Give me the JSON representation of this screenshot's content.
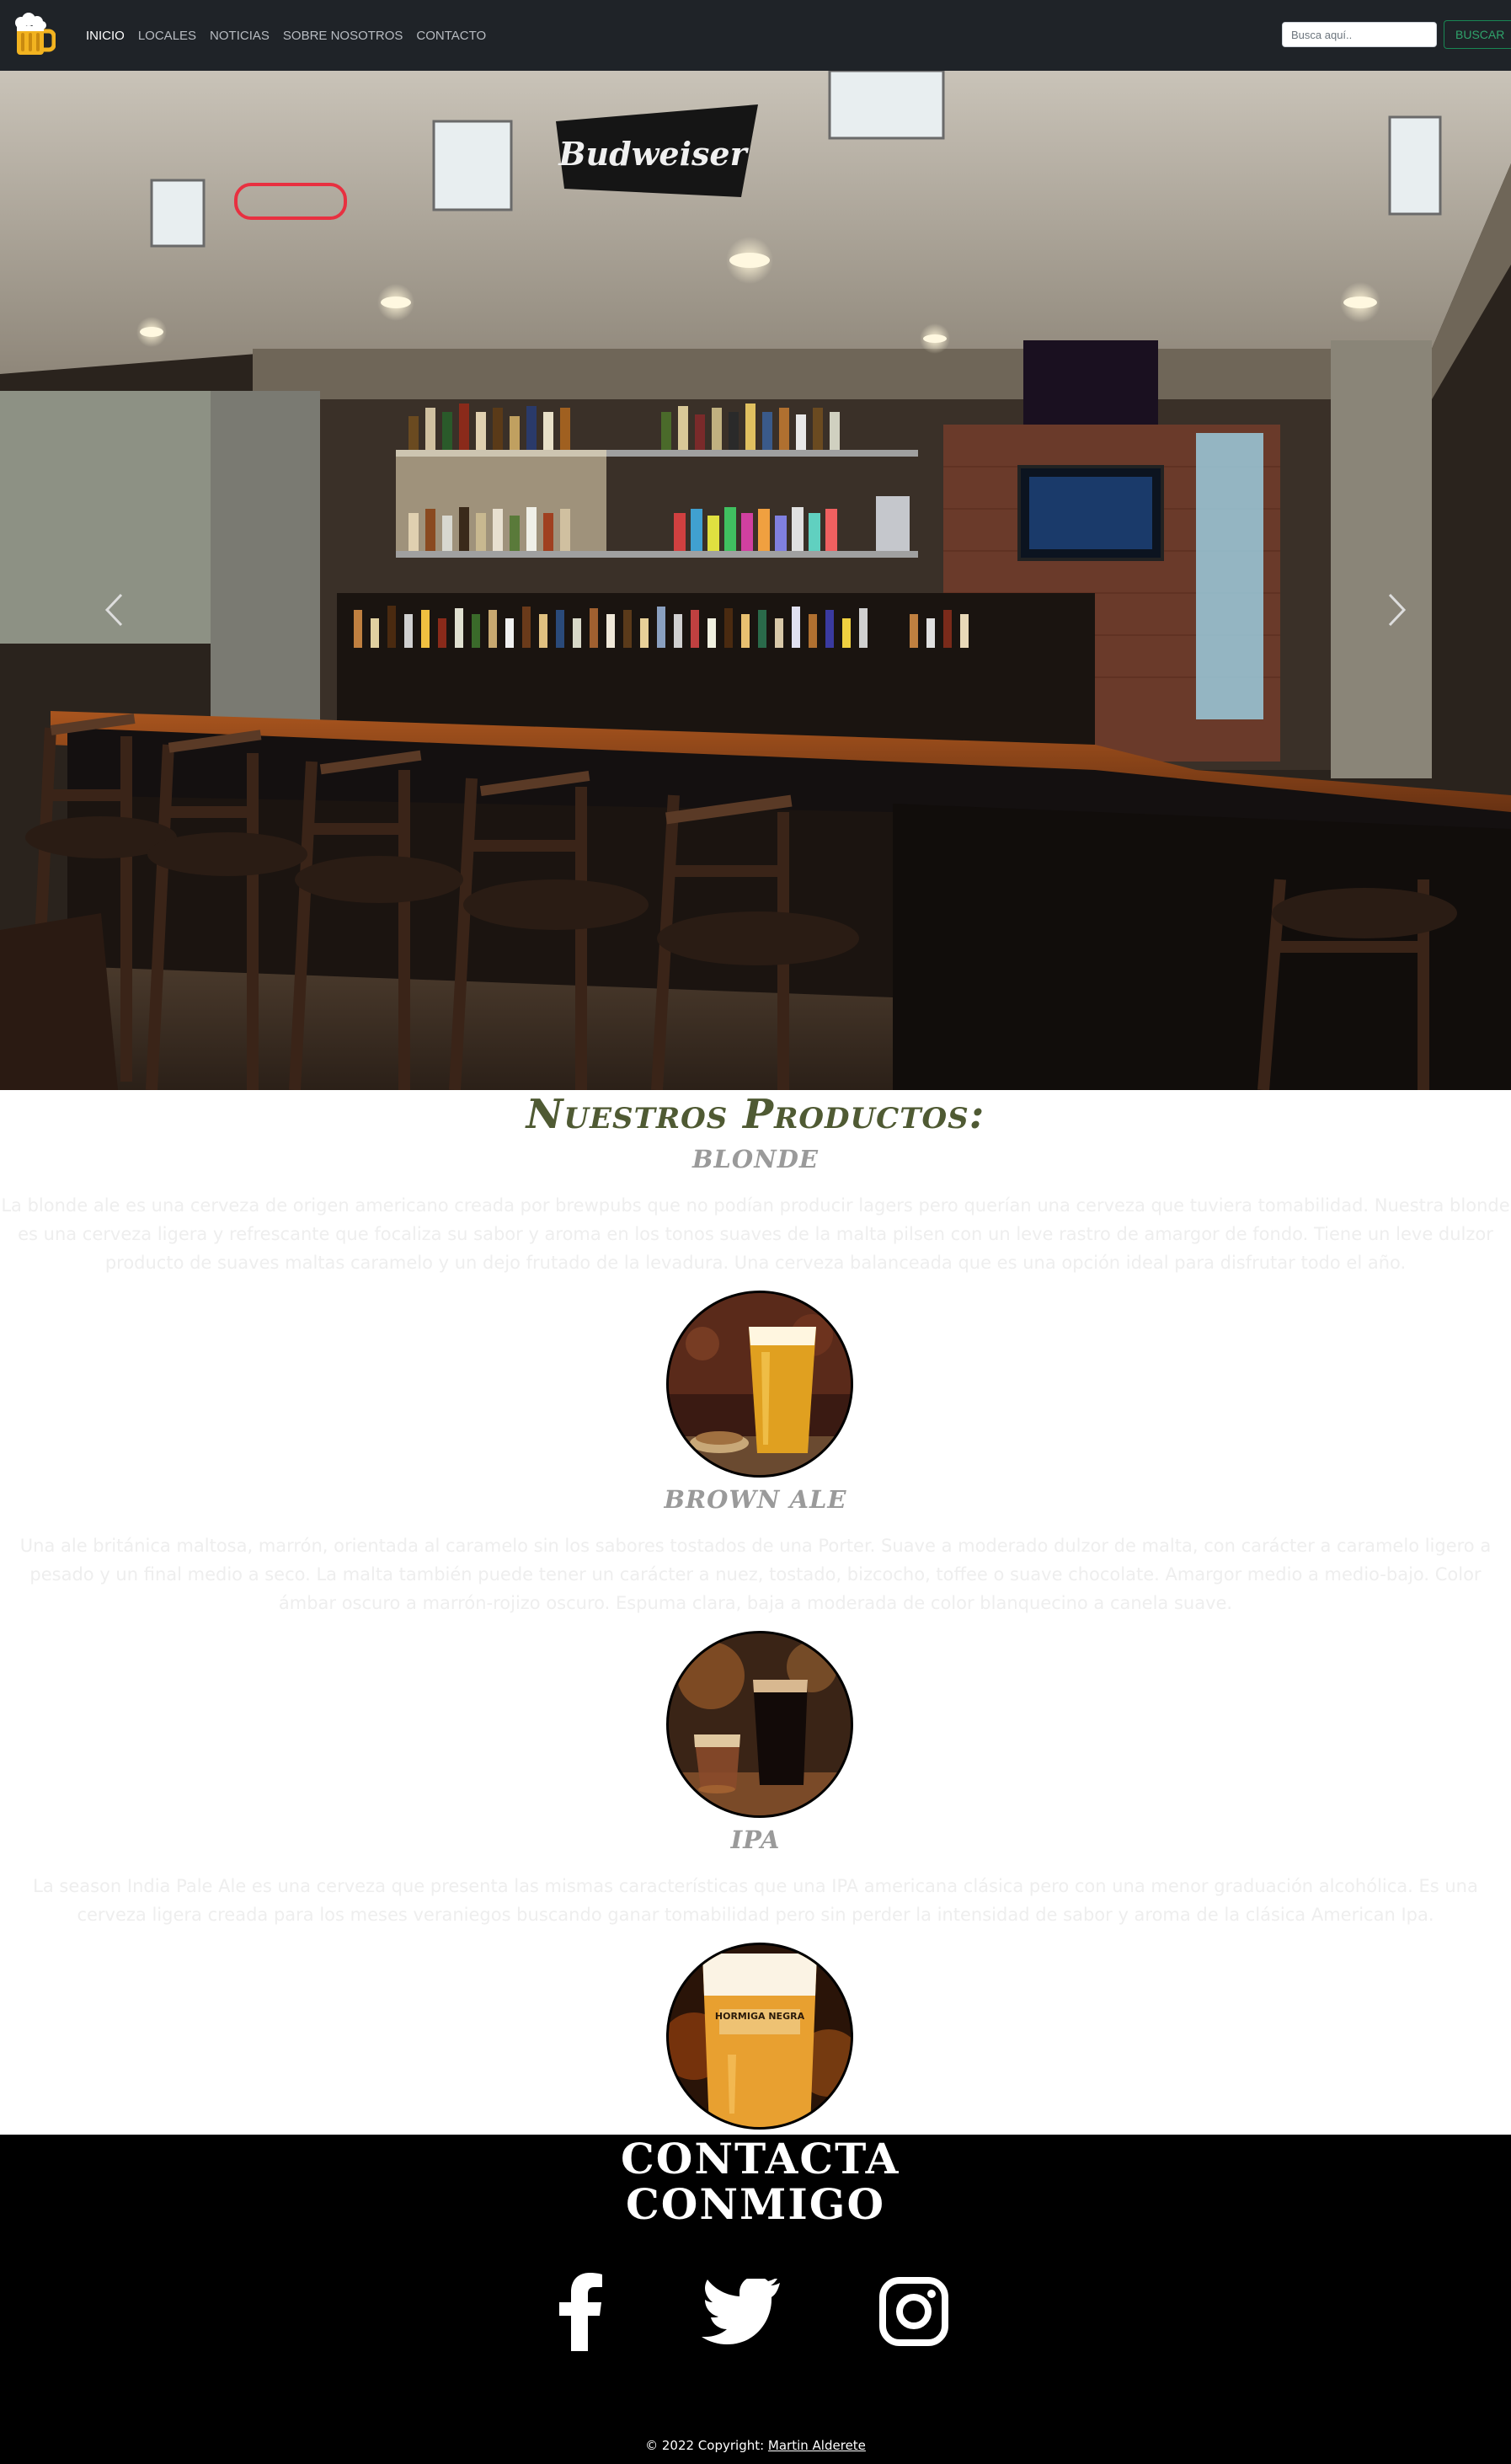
{
  "navbar": {
    "brand_icon": "beer-mug-icon",
    "links": [
      {
        "label": "INICIO",
        "active": true
      },
      {
        "label": "LOCALES",
        "active": false
      },
      {
        "label": "NOTICIAS",
        "active": false
      },
      {
        "label": "SOBRE NOSOTROS",
        "active": false
      },
      {
        "label": "CONTACTO",
        "active": false
      }
    ],
    "search_placeholder": "Busca aquí..",
    "search_button": "BUSCAR",
    "colors": {
      "background": "#1f2328",
      "button_accent": "#198754"
    }
  },
  "carousel": {
    "slide_description": "Bar interior with stools and Budweiser sign",
    "sign_text": "Budweiser",
    "prev_icon": "chevron-left-icon",
    "next_icon": "chevron-right-icon"
  },
  "products": {
    "title": "Nuestros Productos:",
    "items": [
      {
        "name": "BLONDE",
        "description": "La blonde ale es una cerveza de origen americano creada por brewpubs que no podían producir lagers pero querían una cerveza que tuviera tomabilidad. Nuestra blonde es una cerveza ligera y refrescante que focaliza su sabor y aroma en los tonos suaves de la malta pilsen con un leve rastro de amargor de fondo. Tiene un leve dulzor producto de suaves maltas caramelo y un dejo frutado de la levadura. Una cerveza balanceada que es una opción ideal para disfrutar todo el año.",
        "image": "blonde-beer-glass"
      },
      {
        "name": "BROWN ALE",
        "description": "Una ale británica maltosa, marrón, orientada al caramelo sin los sabores tostados de una Porter. Suave a moderado dulzor de malta, con carácter a caramelo ligero a pesado y un final medio a seco. La malta también puede tener un carácter a nuez, tostado, bizcocho, toffee o suave chocolate. Amargor medio a medio-bajo. Color ámbar oscuro a marrón-rojizo oscuro. Espuma clara, baja a moderada de color blanquecino a canela suave.",
        "image": "dark-beer-glasses"
      },
      {
        "name": "IPA",
        "description": "La season India Pale Ale es una cerveza que presenta las mismas características que una IPA americana clásica pero con una menor graduación alcohólica. Es una cerveza ligera creada para los meses veraniegos buscando ganar tomabilidad pero sin perder la intensidad de sabor y aroma de la clásica American Ipa.",
        "image": "ipa-beer-glass",
        "glass_text": "HORMIGA NEGRA"
      }
    ]
  },
  "footer": {
    "title": "CONTACTA CONMIGO",
    "social": [
      {
        "name": "facebook-icon"
      },
      {
        "name": "twitter-icon"
      },
      {
        "name": "instagram-icon"
      }
    ],
    "copyright_prefix": "© 2022 Copyright: ",
    "copyright_author": "Martin Alderete"
  }
}
